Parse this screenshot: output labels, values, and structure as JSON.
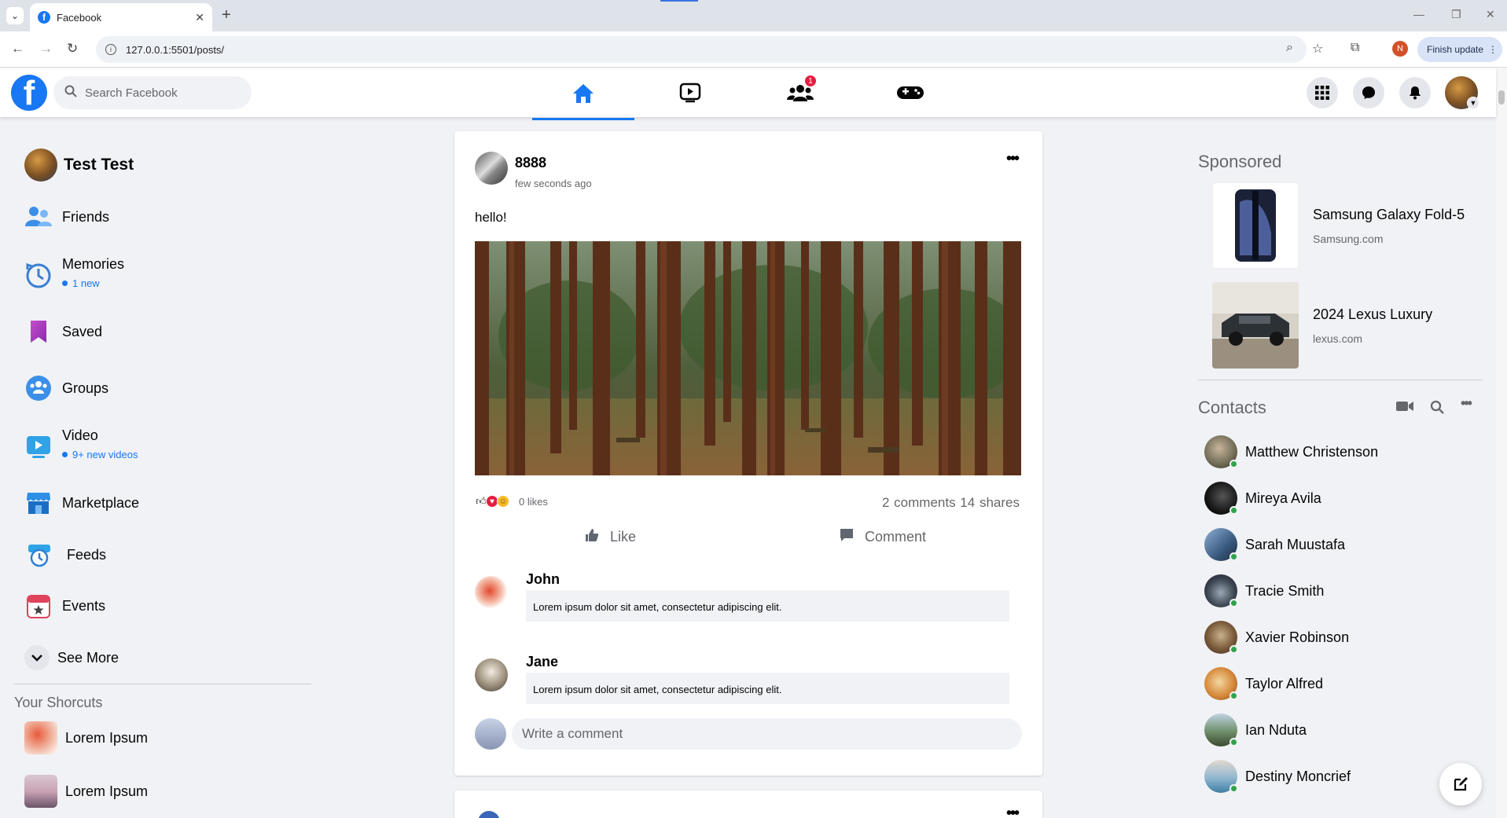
{
  "browser": {
    "tab_title": "Facebook",
    "url": "127.0.0.1:5501/posts/",
    "profile_initial": "N",
    "finish_update_label": "Finish update"
  },
  "header": {
    "logo_letter": "f",
    "search_placeholder": "Search Facebook",
    "groups_badge": "1",
    "brand_color": "#1877f2"
  },
  "user": {
    "name": "Test Test"
  },
  "sidebar": {
    "items": [
      {
        "label": "Friends",
        "icon": "friends-icon"
      },
      {
        "label": "Memories",
        "sub": "1 new",
        "icon": "memories-icon"
      },
      {
        "label": "Saved",
        "icon": "saved-icon"
      },
      {
        "label": "Groups",
        "icon": "groups-icon"
      },
      {
        "label": "Video",
        "sub": "9+ new videos",
        "icon": "video-icon"
      },
      {
        "label": "Marketplace",
        "icon": "marketplace-icon"
      },
      {
        "label": "Feeds",
        "icon": "feeds-icon"
      },
      {
        "label": "Events",
        "icon": "events-icon"
      }
    ],
    "see_more": "See More",
    "shortcuts_title": "Your Shorcuts",
    "shortcuts": [
      {
        "label": "Lorem Ipsum"
      },
      {
        "label": "Lorem Ipsum"
      }
    ]
  },
  "post": {
    "author": "8888",
    "time": "few seconds ago",
    "text": "hello!",
    "likes": "0 likes",
    "stats": "2 comments 14 shares",
    "like_label": "Like",
    "comment_label": "Comment",
    "comments": [
      {
        "name": "John",
        "text": "Lorem ipsum dolor sit amet, consectetur adipiscing elit."
      },
      {
        "name": "Jane",
        "text": "Lorem ipsum dolor sit amet, consectetur adipiscing elit."
      }
    ],
    "write_comment_placeholder": "Write a comment"
  },
  "sponsored": {
    "title": "Sponsored",
    "ads": [
      {
        "name": "Samsung Galaxy Fold-5",
        "site": "Samsung.com"
      },
      {
        "name": "2024 Lexus Luxury",
        "site": "lexus.com"
      }
    ]
  },
  "contacts": {
    "title": "Contacts",
    "people": [
      "Matthew Christenson",
      "Mireya Avila",
      "Sarah Muustafa",
      "Tracie Smith",
      "Xavier Robinson",
      "Taylor Alfred",
      "Ian Nduta",
      "Destiny Moncrief"
    ]
  }
}
